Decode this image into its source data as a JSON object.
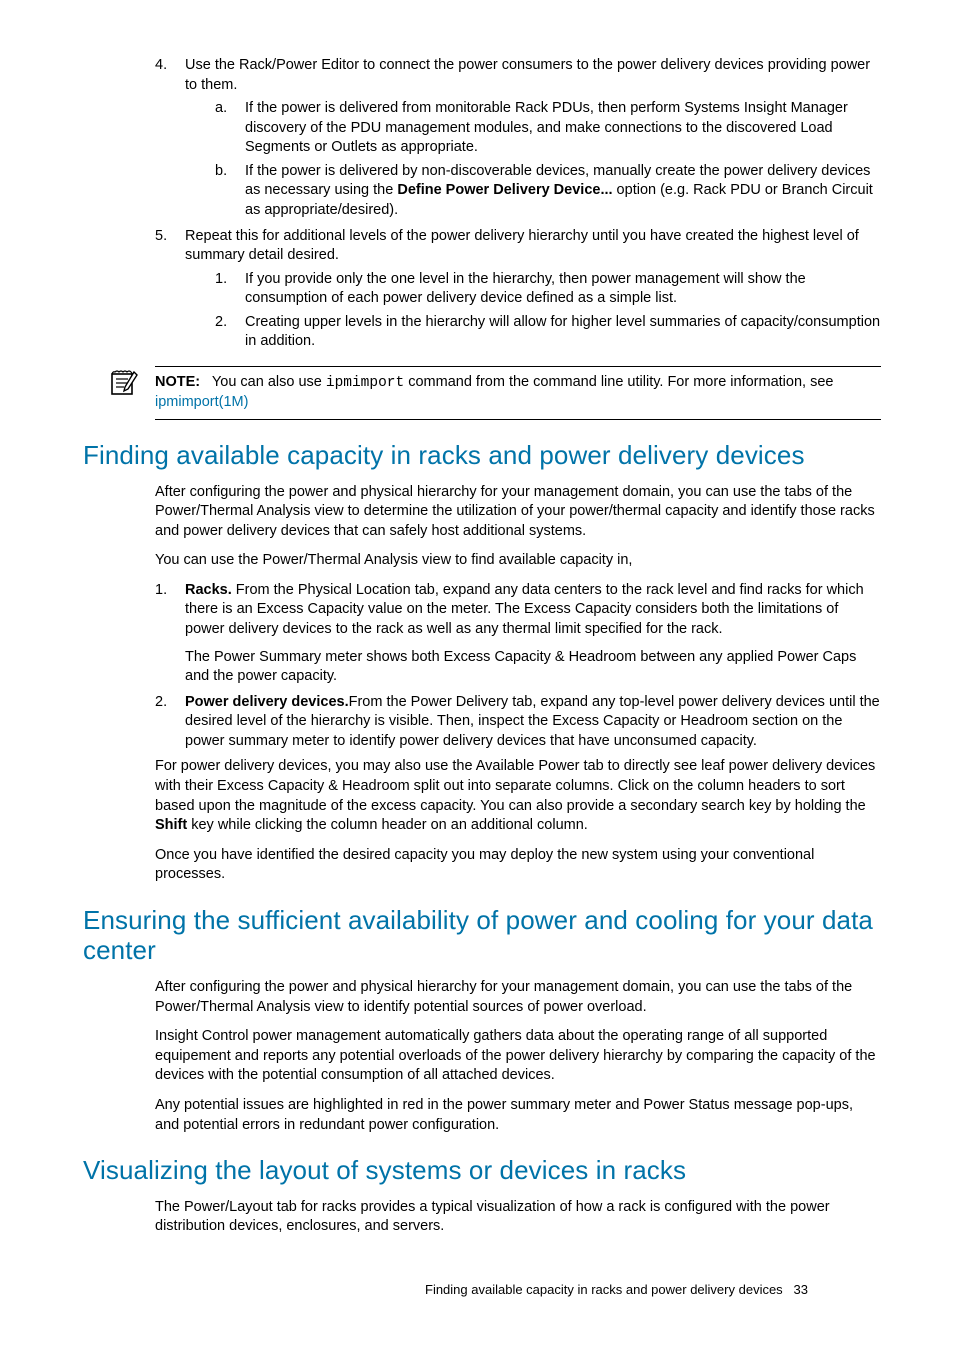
{
  "list_top": {
    "item4": {
      "num": "4.",
      "text_pre": "Use the Rack/Power Editor to connect the power consumers to the power delivery devices providing power to them.",
      "a": {
        "num": "a.",
        "text": "If the power is delivered from monitorable Rack PDUs, then perform Systems Insight Manager discovery of the PDU management modules, and make connections to the discovered Load Segments or Outlets as appropriate."
      },
      "b": {
        "num": "b.",
        "text_pre": "If the power is delivered by non-discoverable devices, manually create the power delivery devices as necessary using the ",
        "bold": "Define Power Delivery Device...",
        "text_post": " option (e.g. Rack PDU or Branch Circuit as appropriate/desired)."
      }
    },
    "item5": {
      "num": "5.",
      "text_pre": "Repeat this for additional levels of the power delivery hierarchy until you have created the highest level of summary detail desired.",
      "s1": {
        "num": "1.",
        "text": "If you provide only the one level in the hierarchy, then power management will show the consumption of each power delivery device defined as a simple list."
      },
      "s2": {
        "num": "2.",
        "text": "Creating upper levels in the hierarchy will allow for higher level summaries of capacity/consumption in addition."
      }
    }
  },
  "note": {
    "label": "NOTE:",
    "pre": "   You can also use ",
    "code": "ipmimport",
    "post": " command from the command line utility. For more information, see ",
    "link": "ipmimport(1M)"
  },
  "h_finding": "Finding available capacity in racks and power delivery devices",
  "finding": {
    "p1": "After configuring the power and physical hierarchy for your management domain, you can use the tabs of the Power/Thermal Analysis view to determine the utilization of your power/thermal capacity and identify those racks and power delivery devices that can safely host additional systems.",
    "p2": "You can use the Power/Thermal Analysis view to find available capacity in,",
    "li1": {
      "num": "1.",
      "bold": "Racks.",
      "text": " From the Physical Location tab, expand any data centers to the rack level and find racks for which there is an Excess Capacity value on the meter. The Excess Capacity considers both the limitations of power delivery devices to the rack as well as any thermal limit specified for the rack.",
      "p2": "The Power Summary meter shows both Excess Capacity & Headroom between any applied Power Caps and the power capacity."
    },
    "li2": {
      "num": "2.",
      "bold": "Power delivery devices.",
      "text": "From the Power Delivery tab, expand any top-level power delivery devices until the desired level of the hierarchy is visible. Then, inspect the Excess Capacity or Headroom section on the power summary meter to identify power delivery devices that have unconsumed capacity."
    },
    "p3_pre": "For power delivery devices, you may also use the Available Power tab to directly see leaf power delivery devices with their Excess Capacity & Headroom split out into separate columns. Click on the column headers to sort based upon the magnitude of the excess capacity. You can also provide a secondary search key by holding the ",
    "p3_bold": "Shift",
    "p3_post": " key while clicking the column header on an additional column.",
    "p4": "Once you have identified the desired capacity you may deploy the new system using your conventional processes."
  },
  "h_ensuring": "Ensuring the sufficient availability of power and cooling for your data center",
  "ensuring": {
    "p1": "After configuring the power and physical hierarchy for your management domain, you can use the tabs of the Power/Thermal Analysis view to identify potential sources of power overload.",
    "p2": "Insight Control power management automatically gathers data about the operating range of all supported equipement and reports any potential overloads of the power delivery hierarchy by comparing the capacity of the devices with the potential consumption of all attached devices.",
    "p3": "Any potential issues are highlighted in red in the power summary meter and Power Status message pop-ups, and potential errors in redundant power configuration."
  },
  "h_visual": "Visualizing the layout of systems or devices in racks",
  "visual": {
    "p1": "The Power/Layout tab for racks provides a typical visualization of how a rack is configured with the power distribution devices, enclosures, and servers."
  },
  "footer": {
    "text": "Finding available capacity in racks and power delivery devices",
    "page": "33"
  }
}
